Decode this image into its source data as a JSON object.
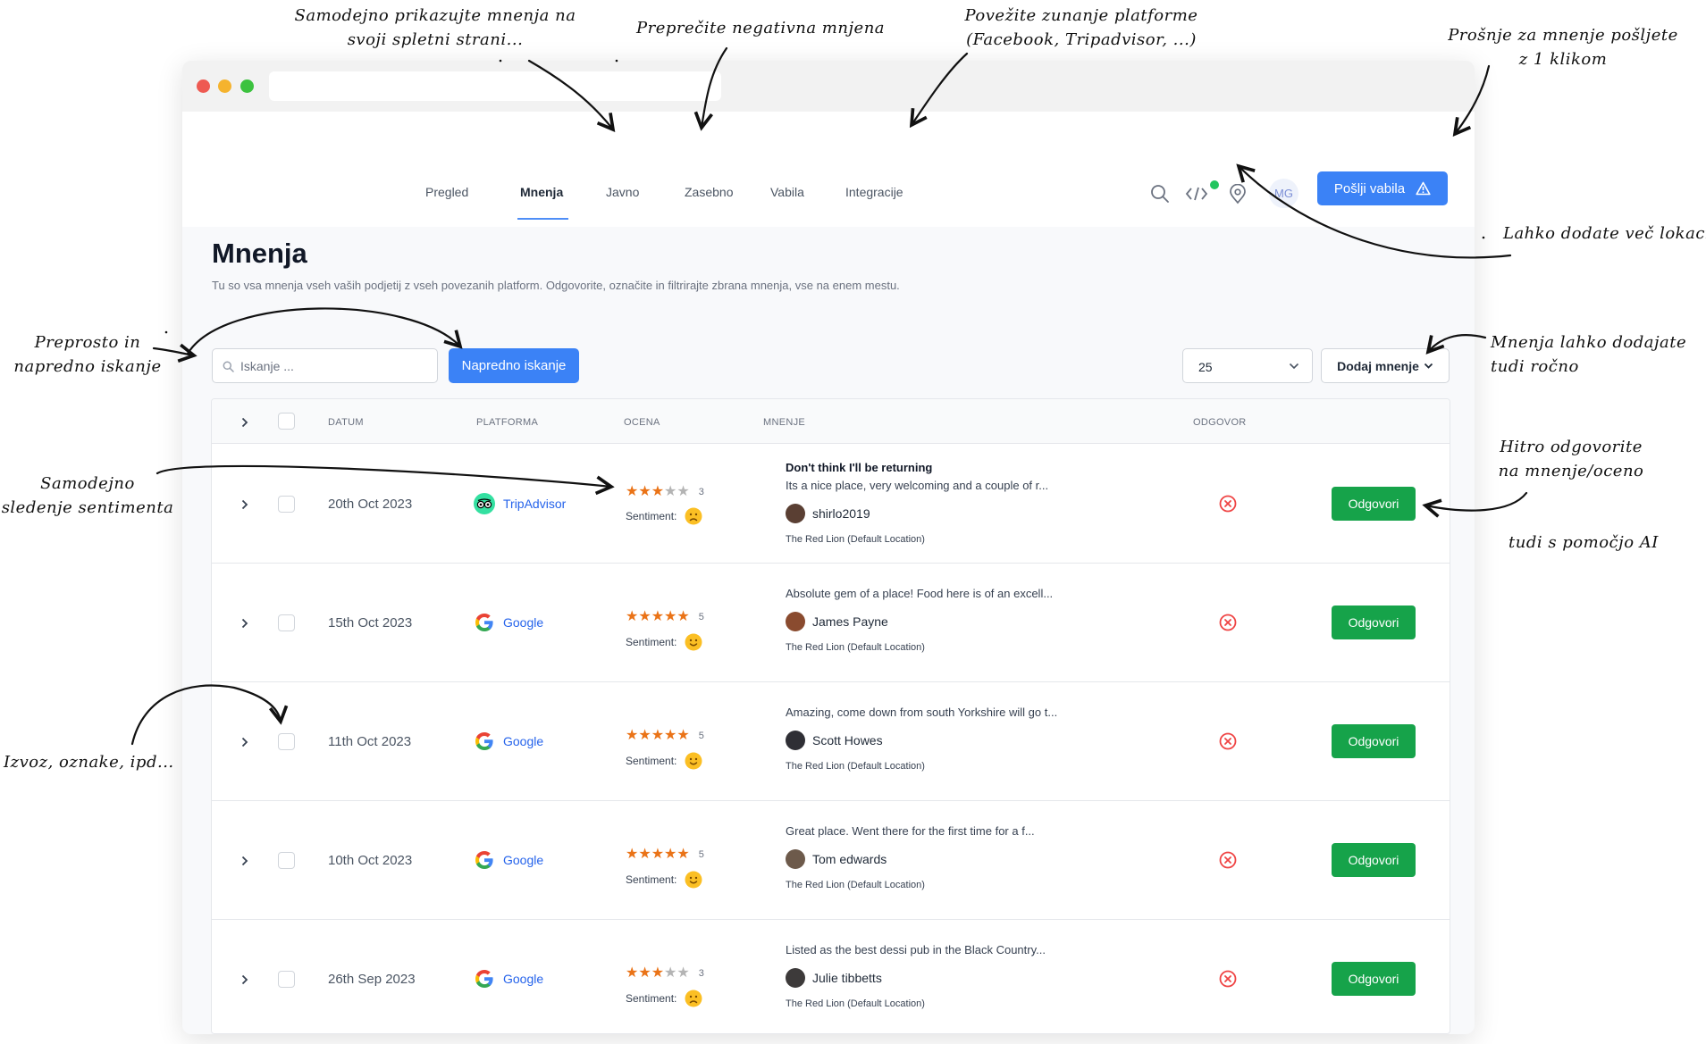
{
  "nav": {
    "tabs": [
      {
        "label": "Pregled"
      },
      {
        "label": "Mnenja"
      },
      {
        "label": "Javno"
      },
      {
        "label": "Zasebno"
      },
      {
        "label": "Vabila"
      },
      {
        "label": "Integracije"
      }
    ],
    "avatar_initials": "MG",
    "send_invites_label": "Pošlji vabila"
  },
  "page": {
    "title": "Mnenja",
    "subtitle": "Tu so vsa mnenja vseh vaših podjetij z vseh povezanih platform. Odgovorite, označite in filtrirajte zbrana mnenja, vse na enem mestu."
  },
  "toolbar": {
    "search_placeholder": "Iskanje ...",
    "advanced_search_label": "Napredno iskanje",
    "page_size": "25",
    "add_review_label": "Dodaj mnenje"
  },
  "table": {
    "headers": {
      "date": "DATUM",
      "platform": "PLATFORMA",
      "rating": "OCENA",
      "review": "MNENJE",
      "reply": "ODGOVOR"
    },
    "sentiment_label": "Sentiment:",
    "reply_button_label": "Odgovori",
    "rows": [
      {
        "date": "20th Oct 2023",
        "platform": "TripAdvisor",
        "rating": 3,
        "rating_text": "3",
        "sentiment": "negative",
        "title": "Don't think I'll be returning",
        "text": "Its a nice place, very welcoming and a couple of r...",
        "author": "shirlo2019",
        "location": "The Red Lion (Default Location)"
      },
      {
        "date": "15th Oct 2023",
        "platform": "Google",
        "rating": 5,
        "rating_text": "5",
        "sentiment": "positive",
        "title": "",
        "text": "Absolute gem of a place! Food here is of an excell...",
        "author": "James Payne",
        "location": "The Red Lion (Default Location)"
      },
      {
        "date": "11th Oct 2023",
        "platform": "Google",
        "rating": 5,
        "rating_text": "5",
        "sentiment": "positive",
        "title": "",
        "text": "Amazing, come down from south Yorkshire will go t...",
        "author": "Scott Howes",
        "location": "The Red Lion (Default Location)"
      },
      {
        "date": "10th Oct 2023",
        "platform": "Google",
        "rating": 5,
        "rating_text": "5",
        "sentiment": "positive",
        "title": "",
        "text": "Great place. Went there for the first time for a f...",
        "author": "Tom edwards",
        "location": "The Red Lion (Default Location)"
      },
      {
        "date": "26th Sep 2023",
        "platform": "Google",
        "rating": 3,
        "rating_text": "3",
        "sentiment": "negative",
        "title": "",
        "text": "Listed as the best dessi pub in the Black Country...",
        "author": "Julie tibbetts",
        "location": "The Red Lion (Default Location)"
      }
    ]
  },
  "annotations": {
    "public_widget": "Samodejno prikazujte mnenja na\nsvoji spletni strani...",
    "private_negative": "Preprečite negativna mnjena",
    "integrations": "Povežite zunanje platforme\n(Facebook, Tripadvisor, ...)",
    "one_click": "Prošnje za mnenje pošljete\nz 1 klikom",
    "locations": "Lahko dodate več lokacij",
    "search": "Preprosto in\nnapredno iskanje",
    "manual_add": "Mnenja lahko dodajate\ntudi ročno",
    "sentiment": "Samodejno\nsledenje sentimenta",
    "reply": "Hitro odgovorite\nna mnenje/oceno",
    "reply_ai": "tudi s pomočjo AI",
    "export": "Izvoz, oznake, ipd..."
  },
  "colors": {
    "primary": "#3b82f6",
    "reply_green": "#16a34a",
    "star": "#ea7317",
    "error_red": "#ef4444",
    "status_dot": "#22c55e"
  }
}
